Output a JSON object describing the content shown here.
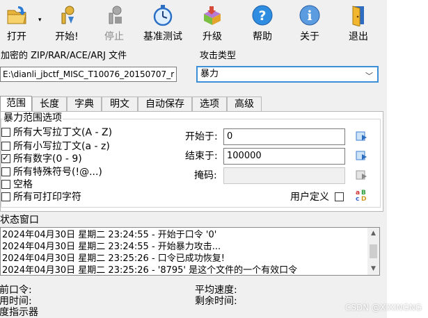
{
  "toolbar": {
    "open": "打开",
    "start": "开始!",
    "stop": "停止",
    "benchmark": "基准测试",
    "upgrade": "升级",
    "help": "帮助",
    "about": "关于",
    "exit": "退出"
  },
  "file_group": {
    "title": "加密的 ZIP/RAR/ACE/ARJ 文件",
    "path": "E:\\dianli_jbctf_MISC_T10076_20150707_r"
  },
  "attack_group": {
    "title": "攻击类型",
    "selected": "暴力"
  },
  "tabs": [
    "范围",
    "长度",
    "字典",
    "明文",
    "自动保存",
    "选项",
    "高级"
  ],
  "range": {
    "legend": "暴力范围选项",
    "options": [
      {
        "label": "所有大写拉丁文(A - Z)",
        "checked": false
      },
      {
        "label": "所有小写拉丁文(a - z)",
        "checked": false
      },
      {
        "label": "所有数字(0 - 9)",
        "checked": true
      },
      {
        "label": "所有特殊符号(!@...)",
        "checked": false
      },
      {
        "label": "空格",
        "checked": false
      },
      {
        "label": "所有可打印字符",
        "checked": false
      }
    ],
    "start_label": "开始于:",
    "start_value": "0",
    "end_label": "结束于:",
    "end_value": "100000",
    "mask_label": "掩码:",
    "mask_value": "",
    "user_defined_label": "用户定义"
  },
  "status": {
    "title": "状态窗口",
    "lines": [
      "2024年04月30日 星期二 23:24:55 - 开始于口令 '0'",
      "2024年04月30日 星期二 23:24:55 - 开始暴力攻击...",
      "2024年04月30日 星期二 23:25:26 - 口令已成功恢复!",
      "2024年04月30日 星期二 23:25:26 - '8795' 是这个文件的一个有效口令"
    ]
  },
  "footer": {
    "current_password": "当前口令:",
    "elapsed": "已用时间:",
    "progress": "进度指示器",
    "avg_speed": "平均速度:",
    "remaining": "剩余时间:"
  },
  "watermark": "CSDN @XIXINGNG",
  "colors": {
    "accent": "#3b8fd9",
    "disabled_text": "#8a8a8a"
  }
}
